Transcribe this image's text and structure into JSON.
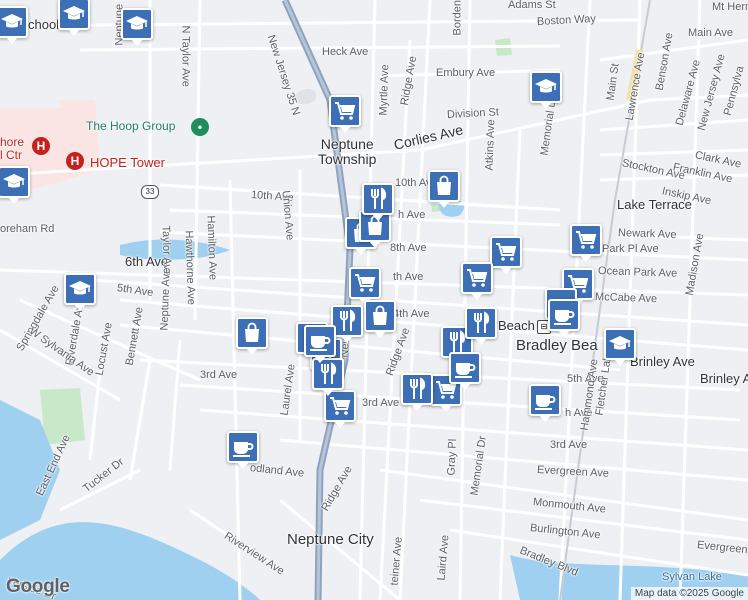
{
  "map": {
    "colors": {
      "land": "#eef0f3",
      "water": "#9fd0f0",
      "park": "#c7e9c9",
      "hospital": "#fbe4e4",
      "road": "#ffffff",
      "highway": "#8ea3bf",
      "pin": "#3d6fb6"
    },
    "labels": {
      "adams": "Adams St",
      "boston": "Boston Way",
      "heck": "Heck Ave",
      "embury": "Embury Ave",
      "borden": "Borden Ave",
      "nj35": "New Jersey 35 N",
      "nepblvd": "Neptune Blvd",
      "ntaylor": "N Taylor Ave",
      "myrtle": "Myrtle Ave",
      "ridge_top": "Ridge Ave",
      "division": "Division St",
      "corlies": "Corlies Ave",
      "hoop": "The Hoop Group",
      "hope": "HOPE Tower",
      "jshore": "hore\nl Ctr",
      "township": "Neptune\nTownship",
      "tenth_w": "10th Ave",
      "tenth_e": "10th Ave",
      "ninth": "h Ave",
      "eighth": "8th Ave",
      "seventh": "th Ave",
      "sixth": "6th Ave",
      "fifth_w": "5th Ave",
      "fourth": "4th Ave",
      "third_w": "3rd Ave",
      "third_mid": "3rd Ave",
      "union": "Union Ave",
      "hamilton": "Hamilton Ave",
      "hawthorne": "Hawthorne Ave",
      "taylor": "Taylor Ave",
      "neptune_ave": "Neptune Ave",
      "springdale": "Springdale Ave",
      "riverdale": "Riverdale Ave",
      "locust": "Locust Ave",
      "bennett": "Bennett Ave",
      "wsylvania": "W Sylvania Ave",
      "eastend": "East End Ave",
      "tucker": "Tucker Dr",
      "woodland": "odland Ave",
      "riverview": "Riverview Ave",
      "riverside": "verside Dr",
      "laurel": "Laurel Ave",
      "ridge_s": "Ridge Ave",
      "ridge_mid": "Ridge Ave",
      "gray": "Gray Pl",
      "steiner": "teiner Ave",
      "laird": "Laird Ave",
      "memorial_n": "Memorial Dr",
      "memorial_s": "Memorial Dr",
      "atkins": "Atkins Ave",
      "main": "Main St",
      "lawrence": "Lawrence Ave",
      "benson": "Benson Ave",
      "mainave": "Main Ave",
      "mtherm": "Mt Herm",
      "delaware": "Delaware Ave",
      "newjersey": "New Jersey Ave",
      "pennsyl": "Pennsylva",
      "clark": "Clark Ave",
      "stockton": "Stockton Ave",
      "franklin": "Franklin Ave",
      "inskip": "Inskip Ave",
      "laketerr": "Lake Terrace",
      "newark": "Newark Ave",
      "parkpl": "Park Pl Ave",
      "oceanpark": "Ocean Park Ave",
      "mccabe": "McCabe Ave",
      "madison": "Madison Ave",
      "brinley_w": "Brinley Ave",
      "brinley_e": "Brinley Ave",
      "fifth_e": "5th Ave",
      "fourth_e": "h Ave",
      "third_e": "3rd Ave",
      "hammond": "Hammond Ave",
      "fletcher": "Fletcher Lake Ave",
      "evergreen": "Evergreen Ave",
      "evergreen_e": "Evergreen",
      "monmouth": "Monmouth Ave",
      "burlington": "Burlington Ave",
      "bradleyblvd": "Bradley Blvd",
      "sylvan": "Sylvan Lake",
      "bradley_beach": "Bradley Bea",
      "beach_frag": "Beach",
      "neptune_city": "Neptune City",
      "oreham": "oreham Rd",
      "sixth_w": "6th Ave",
      "neptune_ave2": "Neptune Ave",
      "school": "chool",
      "new_frag": "New",
      "route33": "33"
    },
    "pins": [
      {
        "type": "school"
      },
      {
        "type": "school"
      },
      {
        "type": "school"
      },
      {
        "type": "school"
      },
      {
        "type": "school"
      },
      {
        "type": "school"
      },
      {
        "type": "school"
      },
      {
        "type": "grocery"
      },
      {
        "type": "grocery"
      },
      {
        "type": "grocery"
      },
      {
        "type": "grocery"
      },
      {
        "type": "grocery"
      },
      {
        "type": "grocery"
      },
      {
        "type": "grocery"
      },
      {
        "type": "grocery"
      },
      {
        "type": "shopping"
      },
      {
        "type": "shopping"
      },
      {
        "type": "shopping"
      },
      {
        "type": "shopping"
      },
      {
        "type": "shopping"
      },
      {
        "type": "shopping"
      },
      {
        "type": "restaurant"
      },
      {
        "type": "restaurant"
      },
      {
        "type": "restaurant"
      },
      {
        "type": "restaurant"
      },
      {
        "type": "restaurant"
      },
      {
        "type": "restaurant"
      },
      {
        "type": "restaurant"
      },
      {
        "type": "cafe"
      },
      {
        "type": "cafe"
      },
      {
        "type": "cafe"
      },
      {
        "type": "cafe"
      },
      {
        "type": "cafe"
      },
      {
        "type": "cafe"
      }
    ],
    "google": "Google",
    "attribution": "Map data ©2025 Google"
  }
}
